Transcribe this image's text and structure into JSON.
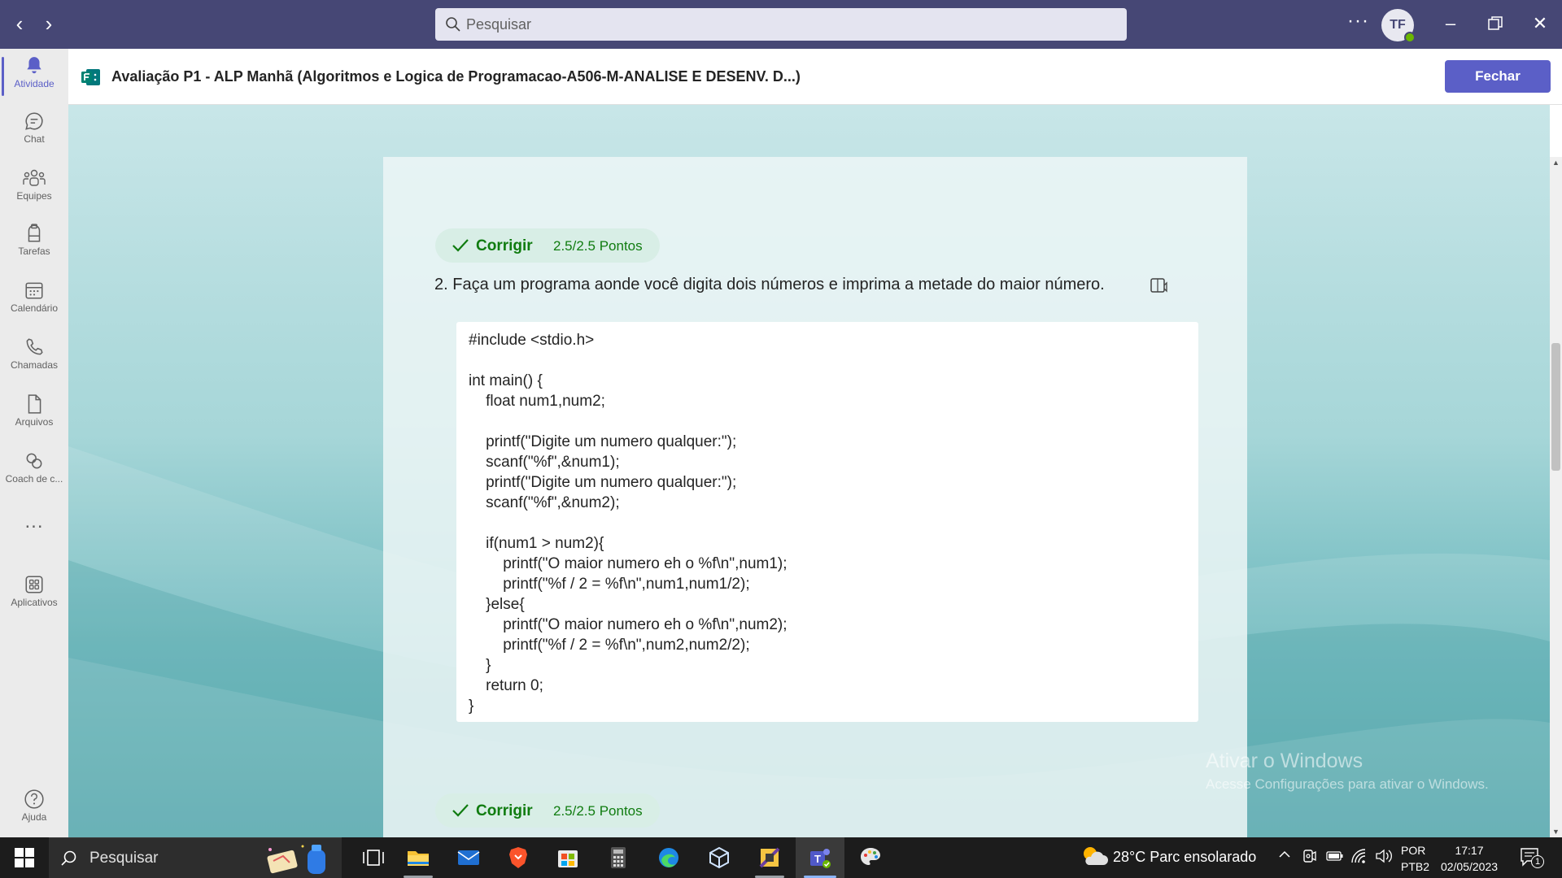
{
  "titlebar": {
    "search_placeholder": "Pesquisar",
    "avatar_initials": "TF"
  },
  "rail": {
    "items": [
      {
        "label": "Atividade",
        "icon": "bell-icon"
      },
      {
        "label": "Chat",
        "icon": "chat-icon"
      },
      {
        "label": "Equipes",
        "icon": "teams-icon"
      },
      {
        "label": "Tarefas",
        "icon": "assignments-icon"
      },
      {
        "label": "Calendário",
        "icon": "calendar-icon"
      },
      {
        "label": "Chamadas",
        "icon": "phone-icon"
      },
      {
        "label": "Arquivos",
        "icon": "file-icon"
      },
      {
        "label": "Coach de c...",
        "icon": "coach-icon"
      },
      {
        "label": "...",
        "icon": "more-icon"
      },
      {
        "label": "Aplicativos",
        "icon": "apps-icon"
      },
      {
        "label": "Ajuda",
        "icon": "help-icon"
      }
    ]
  },
  "header": {
    "title": "Avaliação P1 - ALP Manhã (Algoritmos e Logica de Programacao-A506-M-ANALISE E DESENV. D...)",
    "close_label": "Fechar"
  },
  "quiz": {
    "grade1": {
      "label": "Corrigir",
      "points": "2.5/2.5 Pontos"
    },
    "question": "2. Faça um programa aonde você digita dois números e imprima a metade do maior número.",
    "answer_code": "#include <stdio.h>\n\nint main() {\n    float num1,num2;\n\n    printf(\"Digite um numero qualquer:\");\n    scanf(\"%f\",&num1);\n    printf(\"Digite um numero qualquer:\");\n    scanf(\"%f\",&num2);\n\n    if(num1 > num2){\n        printf(\"O maior numero eh o %f\\n\",num1);\n        printf(\"%f / 2 = %f\\n\",num1,num1/2);\n    }else{\n        printf(\"O maior numero eh o %f\\n\",num2);\n        printf(\"%f / 2 = %f\\n\",num2,num2/2);\n    }\n    return 0;\n}",
    "grade2": {
      "label": "Corrigir",
      "points": "2.5/2.5 Pontos"
    }
  },
  "watermark": {
    "line1": "Ativar o Windows",
    "line2": "Acesse Configurações para ativar o Windows."
  },
  "taskbar": {
    "search_label": "Pesquisar",
    "weather": "28°C  Parc ensolarado",
    "lang_line1": "POR",
    "lang_line2": "PTB2",
    "time": "17:17",
    "date": "02/05/2023",
    "notification_count": "1"
  },
  "colors": {
    "titlebar": "#464775",
    "accent": "#5b5fc7",
    "success": "#107c10"
  }
}
